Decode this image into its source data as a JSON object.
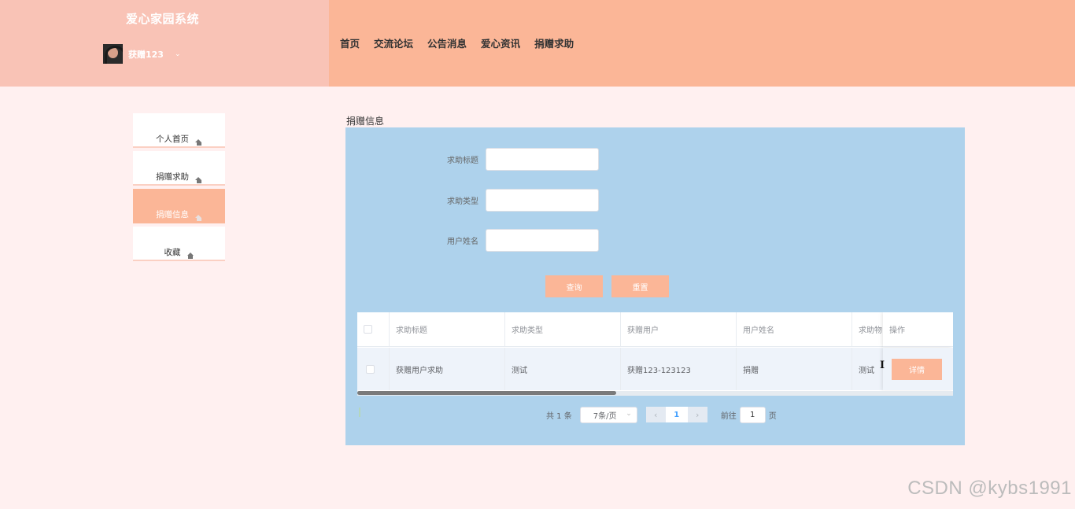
{
  "app": {
    "title": "爱心家园系统"
  },
  "user": {
    "name": "获赠123",
    "caret": "⌄"
  },
  "topnav": [
    "首页",
    "交流论坛",
    "公告消息",
    "爱心资讯",
    "捐赠求助"
  ],
  "sidebar": {
    "items": [
      {
        "label": "个人首页",
        "active": false
      },
      {
        "label": "捐赠求助",
        "active": false
      },
      {
        "label": "捐赠信息",
        "active": true
      },
      {
        "label": "收藏",
        "active": false
      }
    ]
  },
  "main": {
    "section_title": "捐赠信息",
    "form": {
      "fields": [
        {
          "label": "求助标题",
          "value": ""
        },
        {
          "label": "求助类型",
          "value": ""
        },
        {
          "label": "用户姓名",
          "value": ""
        }
      ],
      "search_button": "查询",
      "reset_button": "重置"
    },
    "table": {
      "headers": [
        "求助标题",
        "求助类型",
        "获赠用户",
        "用户姓名",
        "求助物",
        "操作"
      ],
      "rows": [
        {
          "title": "获赠用户求助",
          "type": "测试",
          "recipient": "获赠123-123123",
          "username": "捐赠",
          "item": "测试",
          "action": "详情"
        }
      ]
    },
    "pagination": {
      "total": "共 1 条",
      "page_size": "7条/页",
      "prev": "‹",
      "current": "1",
      "next": "›",
      "goto_label": "前往",
      "goto_value": "1",
      "page_unit": "页"
    }
  },
  "watermark": "CSDN @kybs1991",
  "colors": {
    "header_left": "#f9c3b6",
    "header_right": "#fbb697",
    "panel": "#aed2ec",
    "accent": "#fbb697",
    "background": "#fff0f0"
  }
}
